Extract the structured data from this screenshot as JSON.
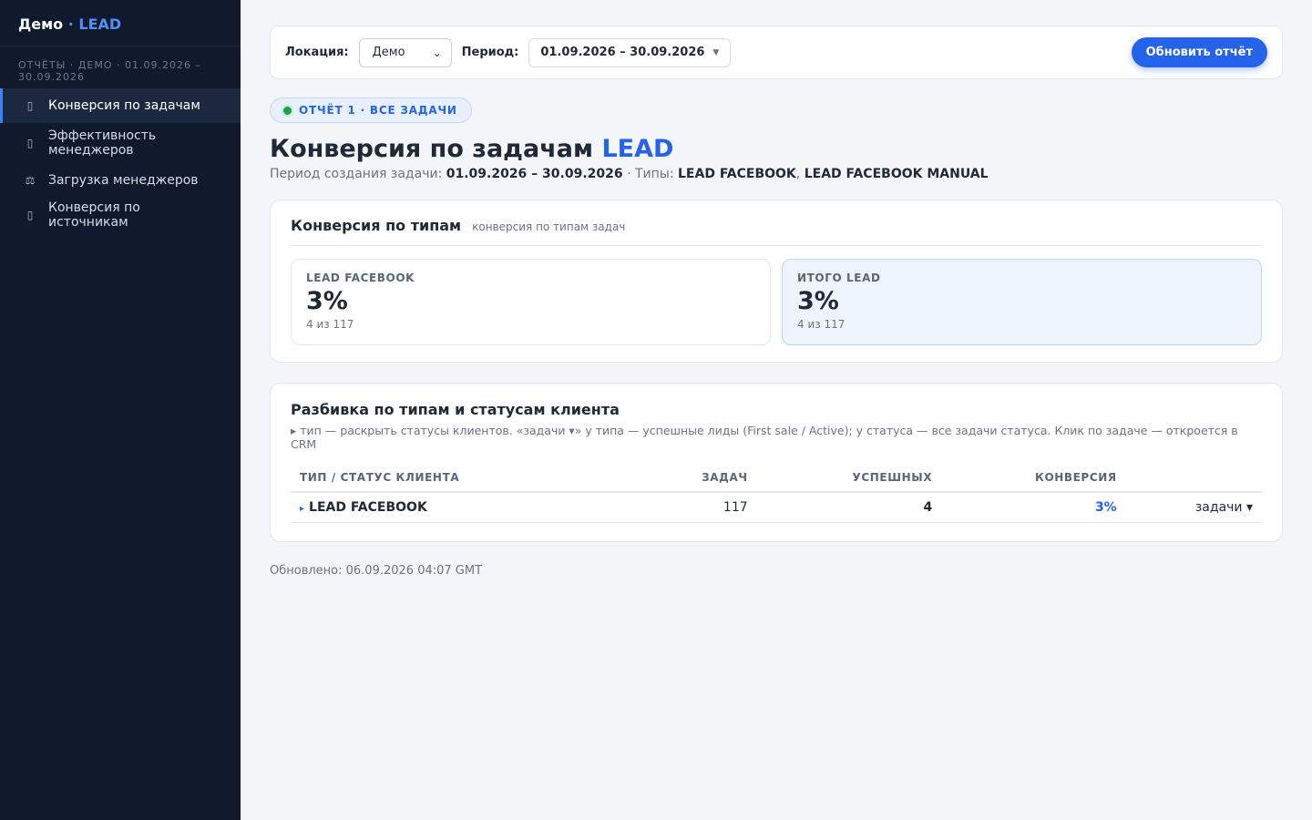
{
  "brand": {
    "name": "Демо",
    "separator": "·",
    "accent": "LEAD"
  },
  "sidebar": {
    "caption": "ОТЧЁТЫ · ДЕМО · 01.09.2026 – 30.09.2026",
    "items": [
      {
        "icon": "chart-icon",
        "glyph": "▯",
        "label": "Конверсия по задачам",
        "active": true
      },
      {
        "icon": "trophy-icon",
        "glyph": "▯",
        "label": "Эффективность менеджеров",
        "active": false
      },
      {
        "icon": "scales-icon",
        "glyph": "⚖",
        "label": "Загрузка менеджеров",
        "active": false
      },
      {
        "icon": "globe-icon",
        "glyph": "▯",
        "label": "Конверсия по источникам",
        "active": false
      }
    ]
  },
  "toolbar": {
    "location_label": "Локация:",
    "location_value": "Демо",
    "period_label": "Период:",
    "period_value": "01.09.2026 – 30.09.2026",
    "refresh_label": "Обновить отчёт"
  },
  "badge": {
    "text": "ОТЧЁТ 1 · ВСЕ ЗАДАЧИ"
  },
  "page": {
    "title": "Конверсия по задачам",
    "title_accent": "LEAD",
    "subtitle_prefix": "Период создания задачи:",
    "subtitle_period": "01.09.2026 – 30.09.2026",
    "subtitle_types_prefix": "· Типы:",
    "subtitle_type1": "LEAD FACEBOOK",
    "subtitle_comma": ",",
    "subtitle_type2": "LEAD FACEBOOK MANUAL"
  },
  "conversion_card": {
    "title": "Конверсия по типам",
    "hint": "конверсия по типам задач",
    "stats": [
      {
        "label": "LEAD FACEBOOK",
        "value": "3%",
        "sub": "4 из 117"
      },
      {
        "label": "ИТОГО LEAD",
        "value": "3%",
        "sub": "4 из 117"
      }
    ]
  },
  "breakdown_card": {
    "title": "Разбивка по типам и статусам клиента",
    "description": "▸ тип — раскрыть статусы клиентов. «задачи ▾» у типа — успешные лиды (First sale / Active); у статуса — все задачи статуса. Клик по задаче — откроется в CRM",
    "columns": [
      "ТИП / СТАТУС КЛИЕНТА",
      "ЗАДАЧ",
      "УСПЕШНЫХ",
      "КОНВЕРСИЯ",
      ""
    ],
    "rows": [
      {
        "expander": "▸",
        "type": "LEAD FACEBOOK",
        "tasks": "117",
        "successful": "4",
        "conversion": "3%",
        "action": "задачи ▾"
      }
    ]
  },
  "footer": {
    "updated": "Обновлено: 06.09.2026 04:07 GMT"
  },
  "colors": {
    "accent": "#2563eb",
    "sidebar_bg": "#111a2d",
    "status_dot": "#16a34a"
  }
}
